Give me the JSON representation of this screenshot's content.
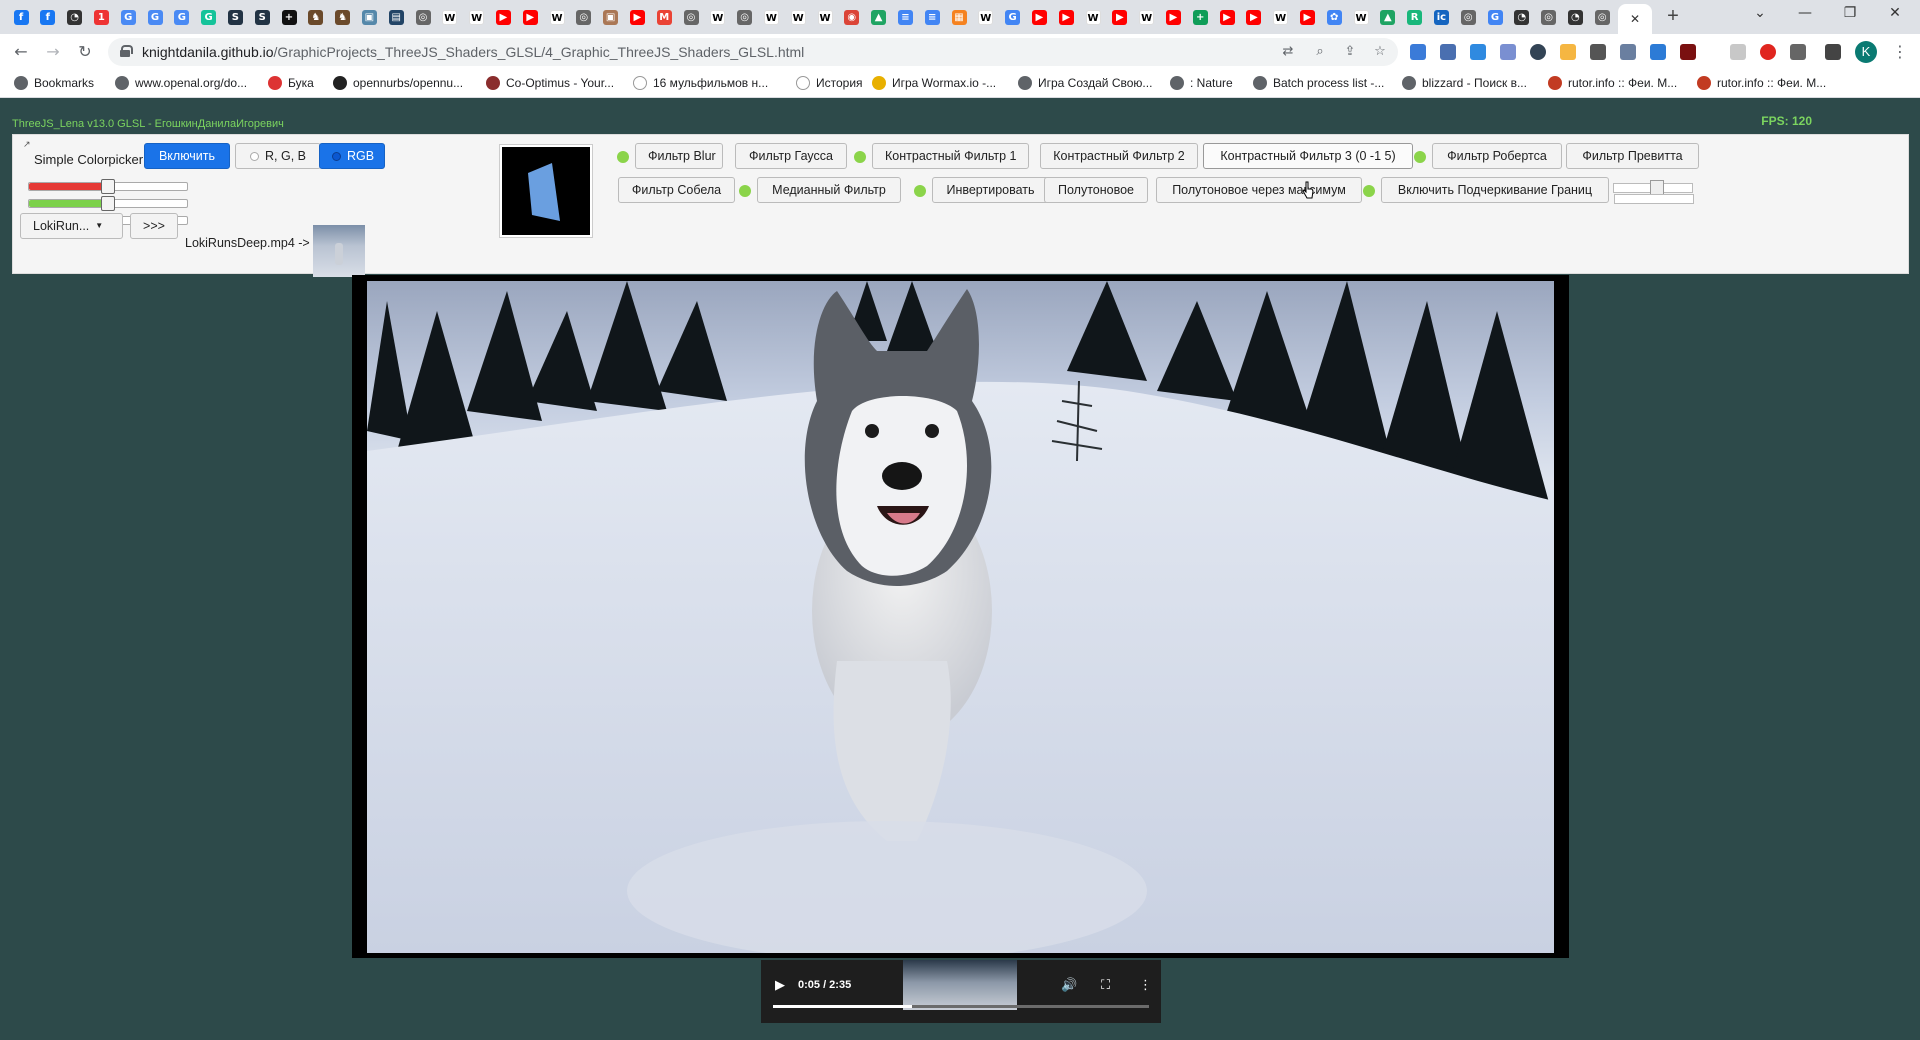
{
  "browser": {
    "tab_icons": [
      "facebook-icon",
      "facebook-icon",
      "github-icon",
      "calendar-icon",
      "translate-icon",
      "translate-icon",
      "translate-icon",
      "grammarly-icon",
      "sds-icon",
      "sds-icon",
      "plus-icon",
      "chess-icon",
      "chess-icon",
      "image-icon",
      "doc-icon",
      "globe-icon",
      "wiki-icon",
      "wiki-icon",
      "youtube-icon",
      "youtube-icon",
      "wiki-icon",
      "globe-icon",
      "picture-icon",
      "youtube-icon",
      "gmail-icon",
      "globe-icon",
      "wiki-icon",
      "globe-icon",
      "wiki-icon",
      "wiki-icon",
      "wiki-icon",
      "chrome-icon",
      "drive-icon",
      "docs-icon",
      "docs-icon",
      "orange-icon",
      "wiki-icon",
      "google-icon",
      "youtube-icon",
      "youtube-icon",
      "wiki-icon",
      "youtube-icon",
      "wiki-icon",
      "youtube-icon",
      "sheets-icon",
      "youtube-icon",
      "youtube-icon",
      "wiki-icon",
      "youtube-icon",
      "gear-icon",
      "wiki-icon",
      "drive-icon",
      "green-icon",
      "ic-icon",
      "globe-icon",
      "google-icon",
      "github-icon",
      "globe-icon",
      "github-icon",
      "globe-icon",
      "google-icon"
    ],
    "url_host": "knightdanila.github.io",
    "url_path": "/GraphicProjects_ThreeJS_Shaders_GLSL/4_Graphic_ThreeJS_Shaders_GLSL.html",
    "profile_initial": "K",
    "bookmarks": [
      {
        "label": "Bookmarks",
        "icon": "star-icon"
      },
      {
        "label": "www.openal.org/do...",
        "icon": "globe-icon"
      },
      {
        "label": "Бука",
        "icon": "buka-icon"
      },
      {
        "label": "opennurbs/opennu...",
        "icon": "github-icon"
      },
      {
        "label": "Co-Optimus - Your...",
        "icon": "coop-icon"
      },
      {
        "label": "16 мульфильмов н...",
        "icon": "ex-icon"
      },
      {
        "label": "История",
        "icon": "history-icon"
      },
      {
        "label": "Игра Wormax.io -...",
        "icon": "wormax-icon"
      },
      {
        "label": "Игра Создай Свою...",
        "icon": "globe-icon"
      },
      {
        "label": ": Nature",
        "icon": "globe-icon"
      },
      {
        "label": "Batch process list -...",
        "icon": "globe-icon"
      },
      {
        "label": "blizzard - Поиск в...",
        "icon": "globe-icon"
      },
      {
        "label": "rutor.info :: Феи. М...",
        "icon": "rutor-icon"
      },
      {
        "label": "rutor.info :: Феи. М...",
        "icon": "rutor-icon"
      }
    ]
  },
  "app": {
    "title": "ThreeJS_Lena v13.0 GLSL - ЕгошкинДанилаИгоревич",
    "fps": "FPS: 120",
    "corner_mark": "↗",
    "colorpicker": {
      "label": "Simple Colorpicker",
      "enable_label": "Включить",
      "mode_rgb_split": "R, G, B",
      "mode_rgb": "RGB",
      "sliders": [
        {
          "name": "red",
          "color": "#e53935",
          "value": 0.5
        },
        {
          "name": "green",
          "color": "#7cd14a",
          "value": 0.5
        },
        {
          "name": "blue",
          "color": "#6a9ed8",
          "value": 0.5
        }
      ]
    },
    "video": {
      "dropdown_label": "LokiRun...",
      "next_label": ">>>",
      "file_label": "LokiRunsDeep.mp4 ->"
    },
    "filters_row1": [
      {
        "label": "Фильтр Blur",
        "dot": true
      },
      {
        "label": "Фильтр Гаусса",
        "dot": false
      },
      {
        "label": "Контрастный Фильтр 1",
        "dot": true
      },
      {
        "label": "Контрастный Фильтр 2",
        "dot": false
      },
      {
        "label": "Контрастный Фильтр 3 (0 -1 5)",
        "dot": false
      },
      {
        "label": "Фильтр Робертса",
        "dot": true
      },
      {
        "label": "Фильтр Превитта",
        "dot": false
      }
    ],
    "filters_row2": [
      {
        "label": "Фильтр Собела",
        "dot": false
      },
      {
        "label": "Медианный Фильтр",
        "dot": true
      },
      {
        "label": "Инвертировать",
        "dot": true
      },
      {
        "label": "Полутоновое",
        "dot": false
      },
      {
        "label": "Полутоновое через максимум",
        "dot": false
      },
      {
        "label": "Включить Подчеркивание Границ",
        "dot": true
      }
    ]
  },
  "player": {
    "time": "0:05 / 2:35",
    "progress": 0.37
  }
}
